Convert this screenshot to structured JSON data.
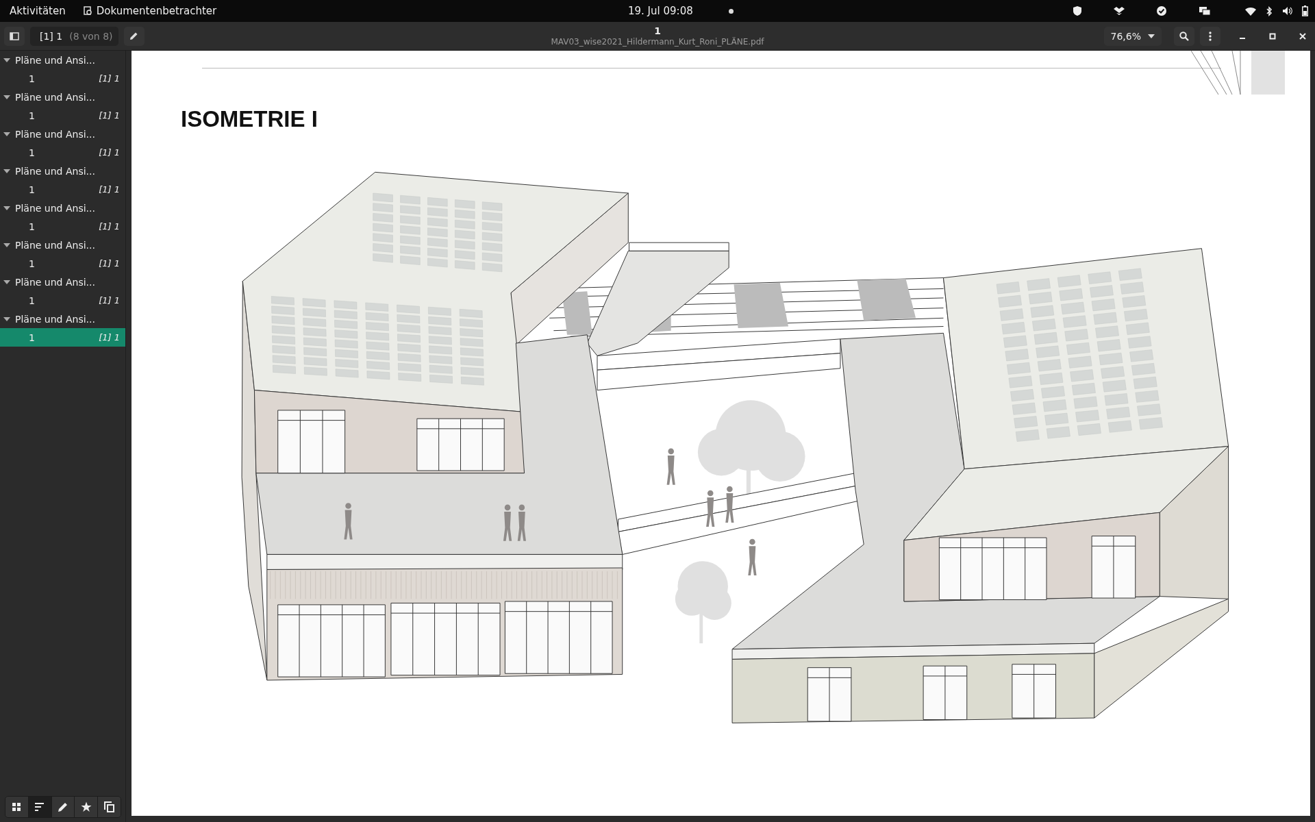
{
  "top_bar": {
    "activities": "Aktivitäten",
    "app_name": "Dokumentenbetrachter",
    "clock": "19. Jul  09:08",
    "notification_dot": true
  },
  "header": {
    "page_field": "[1] 1",
    "page_count": "(8 von 8)",
    "title": "1",
    "subtitle": "MAV03_wise2021_Hildermann_Kurt_Roni_PLÄNE.pdf",
    "zoom": "76,6%"
  },
  "outline": [
    {
      "title": "Pläne und Ansi...",
      "expanded": true,
      "children": [
        {
          "title": "1",
          "page": "[1] 1",
          "selected": false
        }
      ]
    },
    {
      "title": "Pläne und Ansi...",
      "expanded": true,
      "children": [
        {
          "title": "1",
          "page": "[1] 1",
          "selected": false
        }
      ]
    },
    {
      "title": "Pläne und Ansi...",
      "expanded": true,
      "children": [
        {
          "title": "1",
          "page": "[1] 1",
          "selected": false
        }
      ]
    },
    {
      "title": "Pläne und Ansi...",
      "expanded": true,
      "children": [
        {
          "title": "1",
          "page": "[1] 1",
          "selected": false
        }
      ]
    },
    {
      "title": "Pläne und Ansi...",
      "expanded": true,
      "children": [
        {
          "title": "1",
          "page": "[1] 1",
          "selected": false
        }
      ]
    },
    {
      "title": "Pläne und Ansi...",
      "expanded": true,
      "children": [
        {
          "title": "1",
          "page": "[1] 1",
          "selected": false
        }
      ]
    },
    {
      "title": "Pläne und Ansi...",
      "expanded": true,
      "children": [
        {
          "title": "1",
          "page": "[1] 1",
          "selected": false
        }
      ]
    },
    {
      "title": "Pläne und Ansi...",
      "expanded": true,
      "children": [
        {
          "title": "1",
          "page": "[1] 1",
          "selected": true
        }
      ]
    }
  ],
  "sidebar_tabs": [
    {
      "kind": "thumbnails",
      "selected": false
    },
    {
      "kind": "outline",
      "selected": true
    },
    {
      "kind": "annotations",
      "selected": false
    },
    {
      "kind": "bookmarks",
      "selected": false
    },
    {
      "kind": "layers",
      "selected": false
    }
  ],
  "document": {
    "heading": "ISOMETRIE I"
  }
}
